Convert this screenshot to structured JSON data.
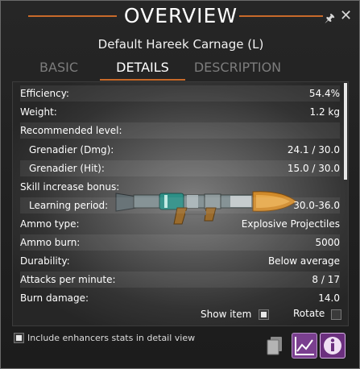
{
  "window": {
    "title": "OVERVIEW",
    "item_name": "Default Hareek Carnage (L)"
  },
  "tabs": [
    {
      "label": "BASIC",
      "active": false
    },
    {
      "label": "DETAILS",
      "active": true
    },
    {
      "label": "DESCRIPTION",
      "active": false
    }
  ],
  "stats": [
    {
      "label": "Efficiency:",
      "value": "54.4%"
    },
    {
      "label": "Weight:",
      "value": "1.2 kg"
    },
    {
      "label": "Recommended level:",
      "value": ""
    },
    {
      "label": "Grenadier (Dmg):",
      "value": "24.1 / 30.0"
    },
    {
      "label": "Grenadier (Hit):",
      "value": "15.0 / 30.0"
    },
    {
      "label": "Skill increase bonus:",
      "value": ""
    },
    {
      "label": "Learning period:",
      "value": "30.0-36.0"
    },
    {
      "label": "Ammo type:",
      "value": "Explosive Projectiles"
    },
    {
      "label": "Ammo burn:",
      "value": "5000"
    },
    {
      "label": "Durability:",
      "value": "Below average"
    },
    {
      "label": "Attacks per minute:",
      "value": "8 / 17"
    },
    {
      "label": "Burn damage:",
      "value": "14.0"
    }
  ],
  "controls": {
    "show_item_label": "Show item",
    "show_item_checked": true,
    "rotate_label": "Rotate",
    "rotate_checked": false,
    "enhancers_label": "Include enhancers stats in detail view",
    "enhancers_checked": true
  },
  "icons": {
    "pin": "pin-icon",
    "close": "close-icon",
    "compare": "compare-icon",
    "chart": "chart-icon",
    "info": "info-icon"
  },
  "colors": {
    "accent": "#c86a2a",
    "chart_button": "#7a3f8f",
    "info_button": "#6b2f7e"
  }
}
